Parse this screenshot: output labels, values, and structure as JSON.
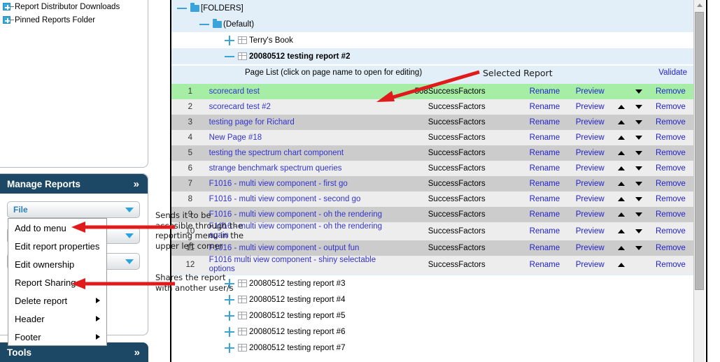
{
  "left_tree": {
    "items": [
      {
        "label": "Report Distributor Downloads",
        "expander": "plus-icon"
      },
      {
        "label": "Pinned Reports Folder",
        "expander": "plus-icon"
      }
    ]
  },
  "manage_reports": {
    "title": "Manage Reports",
    "collapse_icon": "chevron-up-double-icon",
    "dropdowns": [
      {
        "label": "File",
        "caret": "caret-down-icon"
      },
      {
        "label": "",
        "caret": "caret-down-icon"
      },
      {
        "label": "",
        "caret": "caret-down-icon"
      }
    ],
    "file_menu": {
      "items": [
        {
          "label": "Add to menu",
          "submenu": false
        },
        {
          "label": "Edit report properties",
          "submenu": false
        },
        {
          "label": "Edit ownership",
          "submenu": false
        },
        {
          "label": "Report Sharing",
          "submenu": false
        },
        {
          "label": "Delete report",
          "submenu": true
        },
        {
          "label": "Header",
          "submenu": true
        },
        {
          "label": "Footer",
          "submenu": true
        }
      ]
    }
  },
  "tools": {
    "title": "Tools",
    "expand_icon": "chevron-down-double-icon"
  },
  "annotations": {
    "add_to_menu_note": "Sends it to be\naccesible through the\nreporting menu in the\nupper left corner",
    "report_sharing_note": "Shares the report\nwith another user/s",
    "selected_report_note": "Selected Report",
    "arrow_color": "#e01b1b"
  },
  "main": {
    "tree_top": [
      {
        "label": "[FOLDERS]",
        "icon": "folder-icon",
        "expander": "minus-icon",
        "indent": 0,
        "bold": false,
        "bg": "blue"
      },
      {
        "label": "(Default)",
        "icon": "folder-icon",
        "expander": "minus-icon",
        "indent": 1,
        "bold": false,
        "bg": "blue"
      },
      {
        "label": "Terry's Book",
        "icon": "grid-icon",
        "expander": "plus-icon",
        "indent": 2,
        "bold": false,
        "bg": "white"
      },
      {
        "label": "20080512 testing report #2",
        "icon": "grid-icon",
        "expander": "minus-icon",
        "indent": 2,
        "bold": true,
        "bg": "blue"
      }
    ],
    "page_list": {
      "caption": "Page List (click on page name to open for editing)",
      "validate_label": "Validate",
      "columns": [
        "#",
        "name",
        "size",
        "source",
        "rename",
        "preview",
        "up",
        "down",
        "remove"
      ],
      "action_labels": {
        "rename": "Rename",
        "preview": "Preview",
        "remove": "Remove"
      },
      "rows": [
        {
          "num": "1",
          "name": "scorecard test",
          "size": "508",
          "source": "SuccessFactors",
          "up": false,
          "down": true,
          "state": "selected"
        },
        {
          "num": "2",
          "name": "scorecard test #2",
          "size": "",
          "source": "SuccessFactors",
          "up": true,
          "down": true,
          "state": "light"
        },
        {
          "num": "3",
          "name": "testing page for Richard",
          "size": "",
          "source": "SuccessFactors",
          "up": true,
          "down": true,
          "state": "dark"
        },
        {
          "num": "4",
          "name": "New Page #18",
          "size": "",
          "source": "SuccessFactors",
          "up": true,
          "down": true,
          "state": "light"
        },
        {
          "num": "5",
          "name": "testing the spectrum chart component",
          "size": "",
          "source": "SuccessFactors",
          "up": true,
          "down": true,
          "state": "dark"
        },
        {
          "num": "6",
          "name": "strange benchmark spectrum queries",
          "size": "",
          "source": "SuccessFactors",
          "up": true,
          "down": true,
          "state": "light"
        },
        {
          "num": "7",
          "name": "F1016 - multi view component - first go",
          "size": "",
          "source": "SuccessFactors",
          "up": true,
          "down": true,
          "state": "dark"
        },
        {
          "num": "8",
          "name": "F1016 - multi view component - second go",
          "size": "",
          "source": "SuccessFactors",
          "up": true,
          "down": true,
          "state": "light"
        },
        {
          "num": "9",
          "name": "F1016 - multi view component - oh the rendering",
          "size": "",
          "source": "SuccessFactors",
          "up": true,
          "down": true,
          "state": "dark"
        },
        {
          "num": "10",
          "name": "F1016 - multi view component - oh the rendering again",
          "size": "",
          "source": "SuccessFactors",
          "up": true,
          "down": true,
          "state": "light"
        },
        {
          "num": "11",
          "name": "F1016 - multi view component - output fun",
          "size": "",
          "source": "SuccessFactors",
          "up": true,
          "down": true,
          "state": "dark"
        },
        {
          "num": "12",
          "name": "F1016 multi view component - shiny selectable options",
          "size": "",
          "source": "SuccessFactors",
          "up": true,
          "down": false,
          "state": "light"
        }
      ]
    },
    "tree_bottom": [
      {
        "label": "20080512 testing report #3",
        "icon": "grid-icon",
        "expander": "plus-icon"
      },
      {
        "label": "20080512 testing report #4",
        "icon": "grid-icon",
        "expander": "plus-icon"
      },
      {
        "label": "20080512 testing report #5",
        "icon": "grid-icon",
        "expander": "plus-icon"
      },
      {
        "label": "20080512 testing report #6",
        "icon": "grid-icon",
        "expander": "plus-icon"
      },
      {
        "label": "20080512 testing report #7",
        "icon": "grid-icon",
        "expander": "plus-icon"
      }
    ],
    "scrollbar": {
      "up_arrow": "triangle-up-icon"
    }
  },
  "colors": {
    "panel_header": "#1d4865",
    "tree_blue_bg": "#e2eef8",
    "selected_row": "#a6eda6",
    "link": "#2222cc",
    "accent": "#3aa3d9"
  }
}
